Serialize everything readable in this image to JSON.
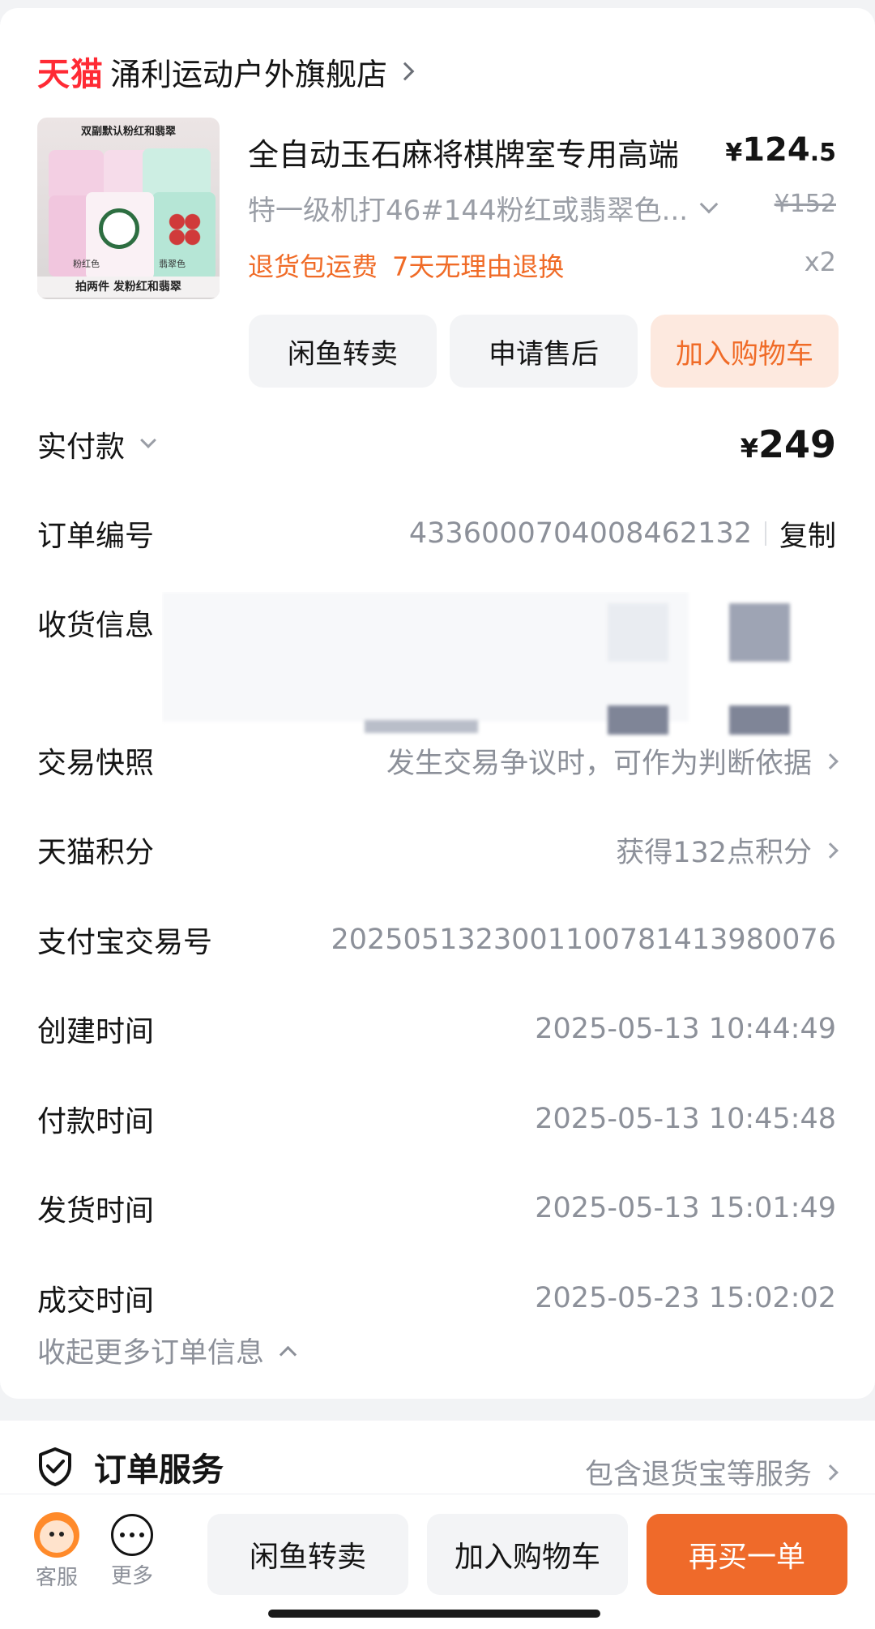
{
  "store": {
    "brand": "天猫",
    "name": "涌利运动户外旗舰店"
  },
  "product": {
    "image_caption_top": "双副默认粉红和翡翠",
    "image_caption_bottom": "拍两件 发粉红和翡翠",
    "image_label_left": "粉红色",
    "image_label_right": "翡翠色",
    "title": "全自动玉石麻将棋牌室专用高端",
    "price_symbol": "¥",
    "price_int": "124",
    "price_dec": ".5",
    "sku": "特一级机打46#144粉红或翡翠色...",
    "original_price": "¥152",
    "tags": [
      "退货包运费",
      "7天无理由退换"
    ],
    "quantity": "x2",
    "actions": {
      "resell": "闲鱼转卖",
      "aftersale": "申请售后",
      "add_cart": "加入购物车"
    }
  },
  "order": {
    "paid_label": "实付款",
    "paid_symbol": "¥",
    "paid_amount": "249",
    "order_no_label": "订单编号",
    "order_no": "4336000704008462132",
    "copy_label": "复制",
    "shipping_label": "收货信息",
    "snapshot_label": "交易快照",
    "snapshot_value": "发生交易争议时，可作为判断依据",
    "points_label": "天猫积分",
    "points_value": "获得132点积分",
    "alipay_label": "支付宝交易号",
    "alipay_value": "2025051323001100781413980076",
    "created_label": "创建时间",
    "created_value": "2025-05-13 10:44:49",
    "paid_time_label": "付款时间",
    "paid_time_value": "2025-05-13 10:45:48",
    "ship_time_label": "发货时间",
    "ship_time_value": "2025-05-13 15:01:49",
    "deal_time_label": "成交时间",
    "deal_time_value": "2025-05-23 15:02:02",
    "collapse_label": "收起更多订单信息"
  },
  "service": {
    "title": "订单服务",
    "summary": "包含退货宝等服务"
  },
  "bottom_bar": {
    "service_label": "客服",
    "more_label": "更多",
    "resell": "闲鱼转卖",
    "add_cart": "加入购物车",
    "rebuy": "再买一单"
  },
  "colors": {
    "accent": "#ef6a2a",
    "tmall_red": "#ff2a34",
    "muted": "#8c9099"
  }
}
